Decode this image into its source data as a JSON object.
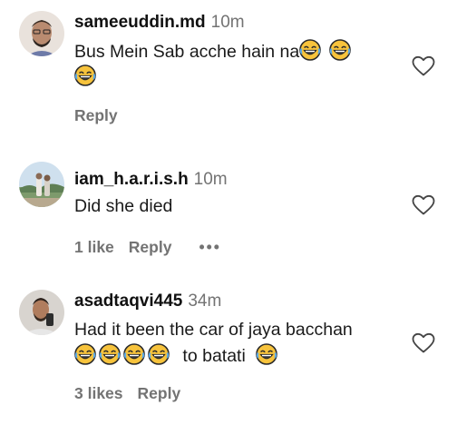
{
  "comments": [
    {
      "username": "sameeuddin.md",
      "time": "10m",
      "text_line1": "Bus Mein Sab acche hain na",
      "text_line2": "",
      "reply_label": "Reply"
    },
    {
      "username": "iam_h.a.r.i.s.h",
      "time": "10m",
      "text_line1": "Did she died",
      "likes_label": "1 like",
      "reply_label": "Reply",
      "more_label": "•••"
    },
    {
      "username": "asadtaqvi445",
      "time": "34m",
      "text_line1": "Had it been the car of jaya bacchan",
      "text_line2_suffix": "to batati",
      "likes_label": "3 likes",
      "reply_label": "Reply"
    }
  ],
  "icons": {
    "emoji": "face-with-tears-of-joy-icon",
    "heart": "heart-outline-icon"
  },
  "colors": {
    "muted": "#737373",
    "emoji_yellow": "#f7c33c"
  }
}
